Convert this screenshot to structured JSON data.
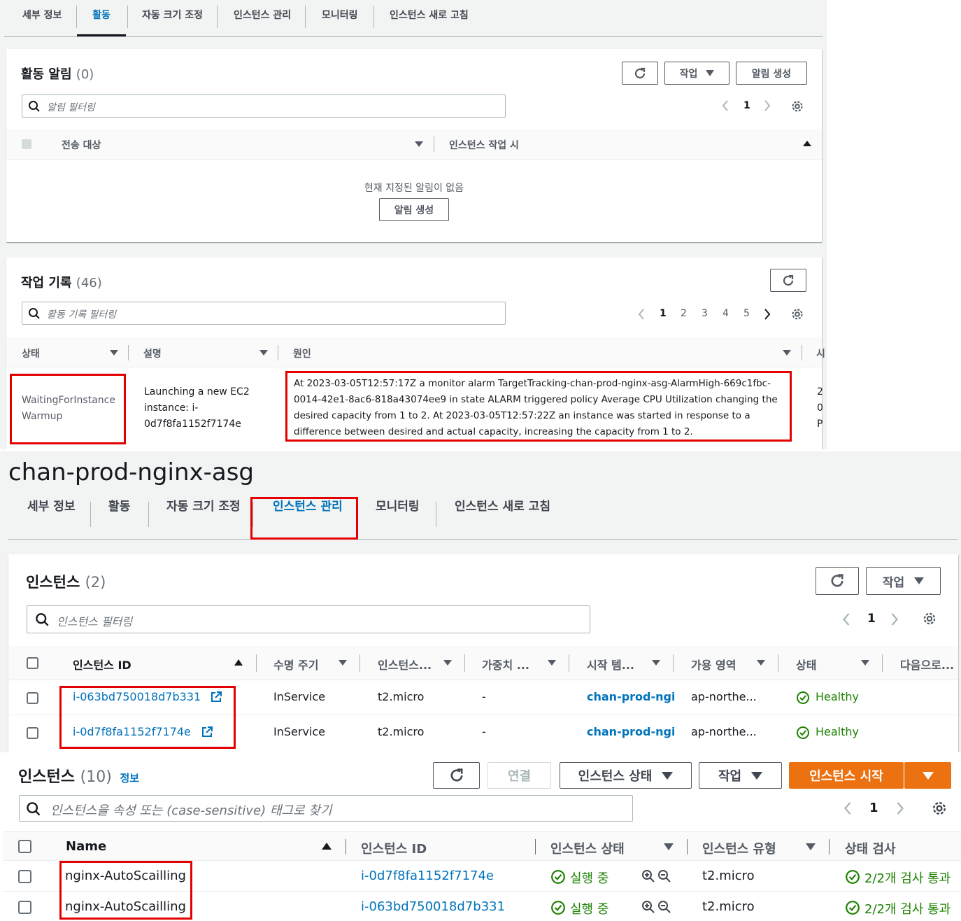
{
  "top": {
    "tabs": [
      "세부 정보",
      "활동",
      "자동 크기 조정",
      "인스턴스 관리",
      "모니터링",
      "인스턴스 새로 고침"
    ],
    "alarms": {
      "title": "활동 알림",
      "count": "(0)",
      "actions_label": "작업",
      "create_label": "알림 생성",
      "search_placeholder": "알림 필터링",
      "page": "1",
      "col_target": "전송 대상",
      "col_when": "인스턴스 작업 시",
      "empty_text": "현재 지정된 알림이 없음",
      "empty_create_label": "알림 생성"
    },
    "history": {
      "title": "작업 기록",
      "count": "(46)",
      "search_placeholder": "활동 기록 필터링",
      "pages": [
        "1",
        "2",
        "3",
        "4",
        "5"
      ],
      "col_status": "상태",
      "col_desc": "설명",
      "col_cause": "원인",
      "col_extra": "시",
      "row": {
        "status_line1": "WaitingForInstance",
        "status_line2": "Warmup",
        "desc_line1": "Launching a new EC2",
        "desc_line2": "instance: i-",
        "desc_line3": "0d7f8fa1152f7174e",
        "cause_line1": "At 2023-03-05T12:57:17Z a monitor alarm TargetTracking-chan-prod-nginx-asg-AlarmHigh-669c1fbc-",
        "cause_line2": "0014-42e1-8ac6-818a43074ee9 in state ALARM triggered policy Average CPU Utilization changing the",
        "cause_line3": "desired capacity from 1 to 2. At 2023-03-05T12:57:22Z an instance was started in response to a",
        "cause_line4": "difference between desired and actual capacity, increasing the capacity from 1 to 2.",
        "extra_line1": "2",
        "extra_line2": "0",
        "extra_line3": "P"
      }
    }
  },
  "asg": {
    "name": "chan-prod-nginx-asg",
    "tabs": [
      "세부 정보",
      "활동",
      "자동 크기 조정",
      "인스턴스 관리",
      "모니터링",
      "인스턴스 새로 고침"
    ],
    "instances": {
      "title": "인스턴스",
      "count": "(2)",
      "actions_label": "작업",
      "search_placeholder": "인스턴스 필터링",
      "page": "1",
      "columns": [
        "인스턴스 ID",
        "수명 주기",
        "인스턴스...",
        "가중치 ...",
        "시작 템...",
        "가용 영역",
        "상태",
        "다음으로..."
      ],
      "rows": [
        {
          "id": "i-063bd750018d7b331",
          "lifecycle": "InService",
          "type": "t2.micro",
          "weight": "-",
          "template": "chan-prod-ngir",
          "az": "ap-northe...",
          "health": "Healthy"
        },
        {
          "id": "i-0d7f8fa1152f7174e",
          "lifecycle": "InService",
          "type": "t2.micro",
          "weight": "-",
          "template": "chan-prod-ngir",
          "az": "ap-northe...",
          "health": "Healthy"
        }
      ]
    }
  },
  "ec2": {
    "title": "인스턴스",
    "count": "(10)",
    "info_label": "정보",
    "connect_label": "연결",
    "state_label": "인스턴스 상태",
    "actions_label": "작업",
    "launch_label": "인스턴스 시작",
    "search_placeholder": "인스턴스을 속성 또는 (case-sensitive) 태그로 찾기",
    "page": "1",
    "columns": [
      "Name",
      "인스턴스 ID",
      "인스턴스 상태",
      "인스턴스 유형",
      "상태 검사"
    ],
    "rows": [
      {
        "name": "nginx-AutoScailling",
        "id": "i-0d7f8fa1152f7174e",
        "state": "실행 중",
        "type": "t2.micro",
        "check": "2/2개 검사 통과"
      },
      {
        "name": "nginx-AutoScailling",
        "id": "i-063bd750018d7b331",
        "state": "실행 중",
        "type": "t2.micro",
        "check": "2/2개 검사 통과"
      }
    ]
  },
  "colors": {
    "link": "#0073bb",
    "ok": "#1d8102",
    "primary": "#ec7211",
    "highlight": "#e40000"
  }
}
